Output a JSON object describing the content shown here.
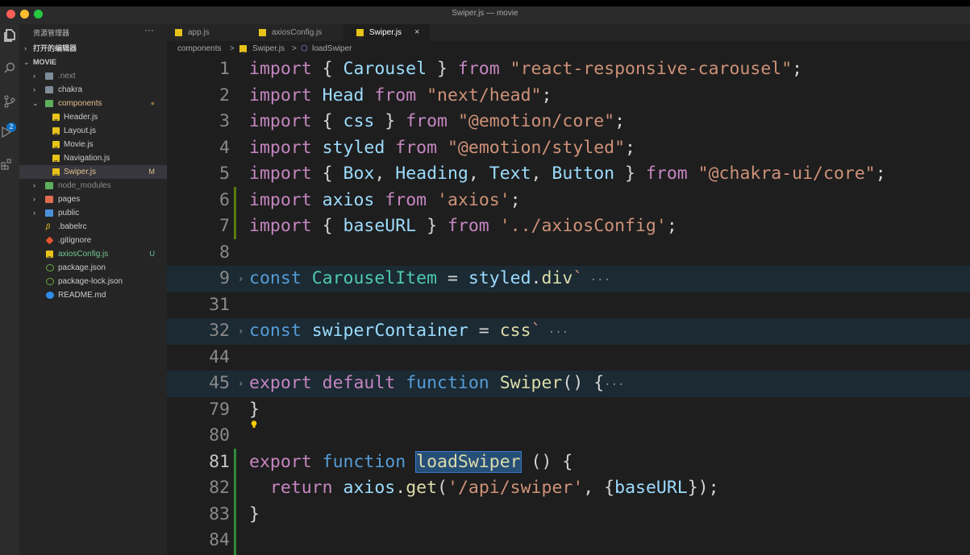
{
  "window": {
    "title": "Swiper.js — movie"
  },
  "activity_bar": {
    "icons": [
      "files-icon",
      "search-icon",
      "source-control-icon",
      "run-debug-icon",
      "extensions-icon"
    ],
    "scm_badge": "2"
  },
  "sidebar": {
    "header": "资源管理器",
    "more": "···",
    "open_editors": "打开的编辑器",
    "project": "MOVIE",
    "items": [
      {
        "label": ".next",
        "status": ""
      },
      {
        "label": "chakra",
        "status": ""
      },
      {
        "label": "components",
        "status": "●"
      },
      {
        "label": "Header.js",
        "status": ""
      },
      {
        "label": "Layout.js",
        "status": ""
      },
      {
        "label": "Movie.js",
        "status": ""
      },
      {
        "label": "Navigation.js",
        "status": ""
      },
      {
        "label": "Swiper.js",
        "status": "M"
      },
      {
        "label": "node_modules",
        "status": ""
      },
      {
        "label": "pages",
        "status": ""
      },
      {
        "label": "public",
        "status": ""
      },
      {
        "label": ".babelrc",
        "status": ""
      },
      {
        "label": ".gitignore",
        "status": ""
      },
      {
        "label": "axiosConfig.js",
        "status": "U"
      },
      {
        "label": "package.json",
        "status": ""
      },
      {
        "label": "package-lock.json",
        "status": ""
      },
      {
        "label": "README.md",
        "status": ""
      }
    ]
  },
  "tabs": [
    {
      "label": "app.js"
    },
    {
      "label": "axiosConfig.js"
    },
    {
      "label": "Swiper.js",
      "close": "×"
    }
  ],
  "breadcrumb": {
    "folder": "components",
    "sep": ">",
    "file": "Swiper.js",
    "symbol": "loadSwiper"
  },
  "editor": {
    "line_numbers": [
      "1",
      "2",
      "3",
      "4",
      "5",
      "6",
      "7",
      "8",
      "9",
      "31",
      "32",
      "44",
      "45",
      "79",
      "80",
      "81",
      "82",
      "83",
      "84"
    ],
    "lines": [
      {
        "t": [
          [
            "import",
            "kw"
          ],
          [
            " { ",
            "pun"
          ],
          [
            "Carousel",
            "var"
          ],
          [
            " } ",
            "pun"
          ],
          [
            "from",
            "kw"
          ],
          [
            " ",
            "pun"
          ],
          [
            "\"react-responsive-carousel\"",
            "str"
          ],
          [
            ";",
            "pun"
          ]
        ]
      },
      {
        "t": [
          [
            "import",
            "kw"
          ],
          [
            " ",
            "pun"
          ],
          [
            "Head",
            "var"
          ],
          [
            " ",
            "pun"
          ],
          [
            "from",
            "kw"
          ],
          [
            " ",
            "pun"
          ],
          [
            "\"next/head\"",
            "str"
          ],
          [
            ";",
            "pun"
          ]
        ]
      },
      {
        "t": [
          [
            "import",
            "kw"
          ],
          [
            " { ",
            "pun"
          ],
          [
            "css",
            "var"
          ],
          [
            " } ",
            "pun"
          ],
          [
            "from",
            "kw"
          ],
          [
            " ",
            "pun"
          ],
          [
            "\"@emotion/core\"",
            "str"
          ],
          [
            ";",
            "pun"
          ]
        ]
      },
      {
        "t": [
          [
            "import",
            "kw"
          ],
          [
            " ",
            "pun"
          ],
          [
            "styled",
            "var"
          ],
          [
            " ",
            "pun"
          ],
          [
            "from",
            "kw"
          ],
          [
            " ",
            "pun"
          ],
          [
            "\"@emotion/styled\"",
            "str"
          ],
          [
            ";",
            "pun"
          ]
        ]
      },
      {
        "t": [
          [
            "import",
            "kw"
          ],
          [
            " { ",
            "pun"
          ],
          [
            "Box",
            "var"
          ],
          [
            ", ",
            "pun"
          ],
          [
            "Heading",
            "var"
          ],
          [
            ", ",
            "pun"
          ],
          [
            "Text",
            "var"
          ],
          [
            ", ",
            "pun"
          ],
          [
            "Button",
            "var"
          ],
          [
            " } ",
            "pun"
          ],
          [
            "from",
            "kw"
          ],
          [
            " ",
            "pun"
          ],
          [
            "\"@chakra-ui/core\"",
            "str"
          ],
          [
            ";",
            "pun"
          ]
        ]
      },
      {
        "t": [
          [
            "import",
            "kw"
          ],
          [
            " ",
            "pun"
          ],
          [
            "axios",
            "var"
          ],
          [
            " ",
            "pun"
          ],
          [
            "from",
            "kw"
          ],
          [
            " ",
            "pun"
          ],
          [
            "'axios'",
            "str"
          ],
          [
            ";",
            "pun"
          ]
        ]
      },
      {
        "t": [
          [
            "import",
            "kw"
          ],
          [
            " { ",
            "pun"
          ],
          [
            "baseURL",
            "var"
          ],
          [
            " } ",
            "pun"
          ],
          [
            "from",
            "kw"
          ],
          [
            " ",
            "pun"
          ],
          [
            "'../axiosConfig'",
            "str"
          ],
          [
            ";",
            "pun"
          ]
        ]
      },
      {
        "t": []
      },
      {
        "t": [
          [
            "const",
            "kw2"
          ],
          [
            " ",
            "pun"
          ],
          [
            "CarouselItem",
            "cls"
          ],
          [
            " = ",
            "pun"
          ],
          [
            "styled",
            "var"
          ],
          [
            ".",
            "pun"
          ],
          [
            "div",
            "fn"
          ],
          [
            "`",
            "str"
          ],
          [
            " ···",
            "ell"
          ]
        ]
      },
      {
        "t": []
      },
      {
        "t": [
          [
            "const",
            "kw2"
          ],
          [
            " ",
            "pun"
          ],
          [
            "swiperContainer",
            "var"
          ],
          [
            " = ",
            "pun"
          ],
          [
            "css",
            "fn"
          ],
          [
            "`",
            "str"
          ],
          [
            " ···",
            "ell"
          ]
        ]
      },
      {
        "t": []
      },
      {
        "t": [
          [
            "export",
            "kw"
          ],
          [
            " ",
            "pun"
          ],
          [
            "default",
            "kw"
          ],
          [
            " ",
            "pun"
          ],
          [
            "function",
            "kw2"
          ],
          [
            " ",
            "pun"
          ],
          [
            "Swiper",
            "fn"
          ],
          [
            "() {",
            "pun"
          ],
          [
            "···",
            "ell"
          ]
        ]
      },
      {
        "t": [
          [
            "}",
            "pun"
          ]
        ]
      },
      {
        "t": []
      },
      {
        "t": [
          [
            "export",
            "kw"
          ],
          [
            " ",
            "pun"
          ],
          [
            "function",
            "kw2"
          ],
          [
            " ",
            "pun"
          ],
          [
            "loadSwiper",
            "fn",
            "sel"
          ],
          [
            " () {",
            "pun"
          ]
        ]
      },
      {
        "t": [
          [
            "  return",
            "kw"
          ],
          [
            " ",
            "pun"
          ],
          [
            "axios",
            "var"
          ],
          [
            ".",
            "pun"
          ],
          [
            "get",
            "fn"
          ],
          [
            "(",
            "pun"
          ],
          [
            "'/api/swiper'",
            "str"
          ],
          [
            ", {",
            "pun"
          ],
          [
            "baseURL",
            "var"
          ],
          [
            "});",
            "pun"
          ]
        ]
      },
      {
        "t": [
          [
            "}",
            "pun"
          ]
        ]
      },
      {
        "t": []
      }
    ]
  }
}
